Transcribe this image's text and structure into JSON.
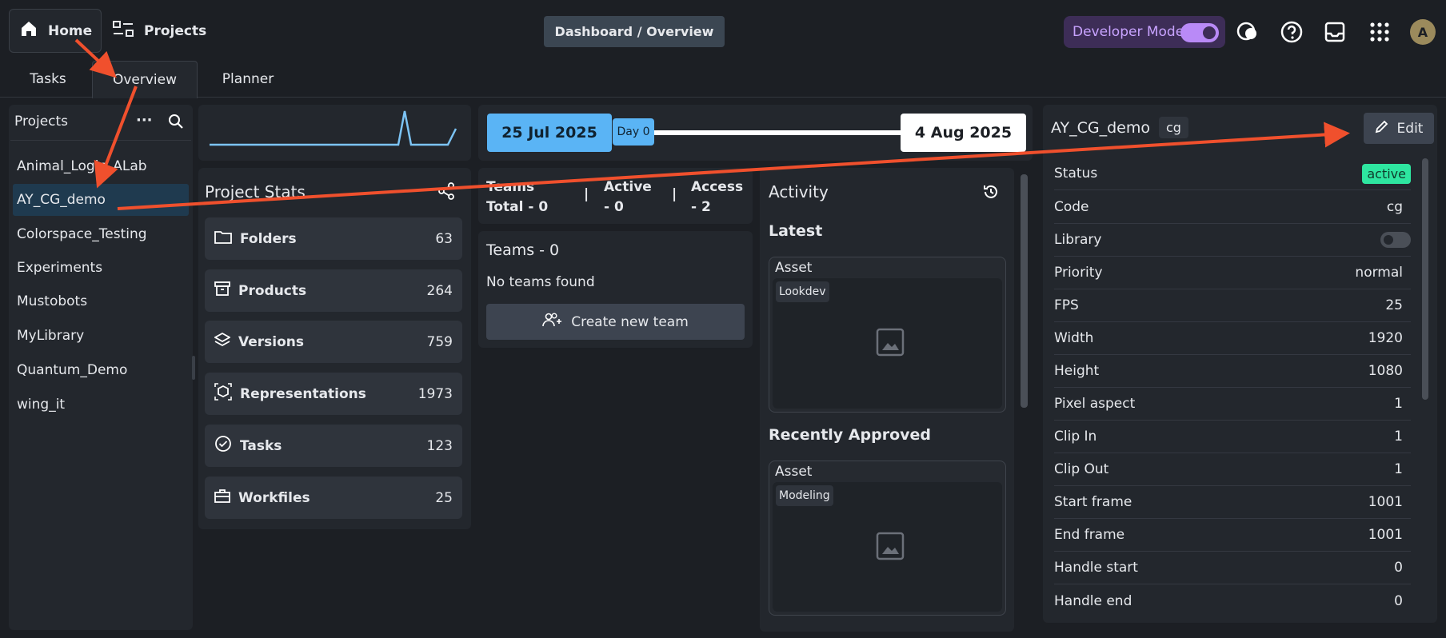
{
  "topbar": {
    "home_label": "Home",
    "projects_label": "Projects",
    "breadcrumb": "Dashboard / Overview",
    "dev_mode_label": "Developer Mode",
    "avatar_initial": "A"
  },
  "tabs": [
    {
      "label": "Tasks"
    },
    {
      "label": "Overview"
    },
    {
      "label": "Planner"
    }
  ],
  "projects": {
    "title": "Projects",
    "items": [
      "Animal_Logic_ALab",
      "AY_CG_demo",
      "Colorspace_Testing",
      "Experiments",
      "Mustobots",
      "MyLibrary",
      "Quantum_Demo",
      "wing_it"
    ],
    "selected": "AY_CG_demo"
  },
  "stats": {
    "title": "Project Stats",
    "items": [
      {
        "label": "Folders",
        "value": "63"
      },
      {
        "label": "Products",
        "value": "264"
      },
      {
        "label": "Versions",
        "value": "759"
      },
      {
        "label": "Representations",
        "value": "1973"
      },
      {
        "label": "Tasks",
        "value": "123"
      },
      {
        "label": "Workfiles",
        "value": "25"
      }
    ]
  },
  "timeline": {
    "start": "25 Jul 2025",
    "day": "Day 0",
    "end": "4 Aug 2025"
  },
  "teams": {
    "total": "Teams",
    "total_line2": "Total - 0",
    "active": "Active",
    "active_line2": "- 0",
    "access": "Access",
    "access_line2": "- 2",
    "sep": "|",
    "title": "Teams - 0",
    "empty": "No teams found",
    "create_label": "Create new team"
  },
  "activity": {
    "title": "Activity",
    "latest": "Latest",
    "latest_type": "Asset",
    "latest_chip": "Lookdev",
    "approved": "Recently Approved",
    "approved_type": "Asset",
    "approved_chip": "Modeling"
  },
  "details": {
    "name": "AY_CG_demo",
    "code_badge": "cg",
    "edit_label": "Edit",
    "status_label": "Status",
    "status_value": "active",
    "rows": [
      {
        "label": "Code",
        "value": "cg"
      },
      {
        "label": "Library",
        "value": ""
      },
      {
        "label": "Priority",
        "value": "normal"
      },
      {
        "label": "FPS",
        "value": "25"
      },
      {
        "label": "Width",
        "value": "1920"
      },
      {
        "label": "Height",
        "value": "1080"
      },
      {
        "label": "Pixel aspect",
        "value": "1"
      },
      {
        "label": "Clip In",
        "value": "1"
      },
      {
        "label": "Clip Out",
        "value": "1"
      },
      {
        "label": "Start frame",
        "value": "1001"
      },
      {
        "label": "End frame",
        "value": "1001"
      },
      {
        "label": "Handle start",
        "value": "0"
      },
      {
        "label": "Handle end",
        "value": "0"
      }
    ]
  },
  "colors": {
    "accent_blue": "#5ab4f5",
    "active_green": "#2ee6a0",
    "annotation_red": "#f0502d",
    "dev_purple": "#c8a3ff"
  }
}
